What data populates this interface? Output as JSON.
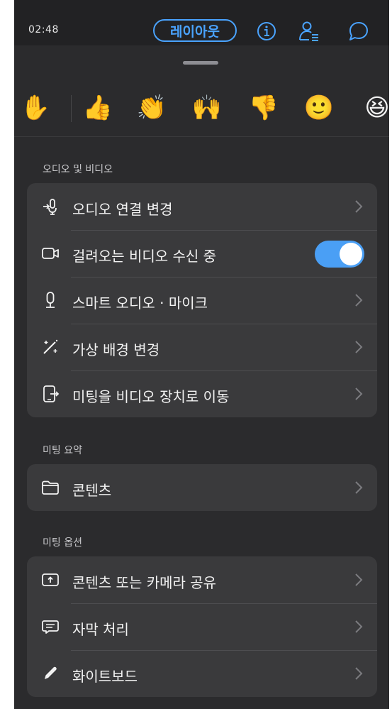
{
  "status_bar": {
    "time": "02:48"
  },
  "header": {
    "layout_button": "레이아웃",
    "icons": [
      "info-icon",
      "participants-icon",
      "chat-icon"
    ],
    "accent_color": "#4aa3ff"
  },
  "reactions": [
    {
      "name": "raise-hand",
      "glyph": "✋"
    },
    {
      "name": "thumbs-up",
      "glyph": "👍"
    },
    {
      "name": "clapping",
      "glyph": "👏"
    },
    {
      "name": "celebrate",
      "glyph": "🙌"
    },
    {
      "name": "thumbs-down",
      "glyph": "👎"
    },
    {
      "name": "smile",
      "glyph": "🙂"
    },
    {
      "name": "laugh",
      "glyph": "😆"
    }
  ],
  "sections": {
    "audio_video": {
      "title": "오디오 및 비디오",
      "items": [
        {
          "label": "오디오 연결 변경",
          "icon": "audio-connect-icon"
        },
        {
          "label": "걸려오는 비디오 수신 중",
          "icon": "video-camera-icon",
          "toggle_on": true
        },
        {
          "label": "스마트 오디오 · 마이크",
          "icon": "microphone-icon"
        },
        {
          "label": "가상 배경 변경",
          "icon": "magic-wand-icon"
        },
        {
          "label": "미팅을 비디오 장치로 이동",
          "icon": "move-to-device-icon"
        }
      ]
    },
    "summary": {
      "title": "미팅 요약",
      "items": [
        {
          "label": "콘텐츠",
          "icon": "folder-icon"
        }
      ]
    },
    "options": {
      "title": "미팅 옵션",
      "items": [
        {
          "label": "콘텐츠 또는 카메라 공유",
          "icon": "share-screen-icon"
        },
        {
          "label": "자막 처리",
          "icon": "captions-icon"
        },
        {
          "label": "화이트보드",
          "icon": "pencil-icon"
        }
      ]
    }
  },
  "colors": {
    "toggle_on": "#4a9ff5",
    "sheet_bg": "#2b2b2d",
    "row_bg": "#3a3a3c"
  }
}
